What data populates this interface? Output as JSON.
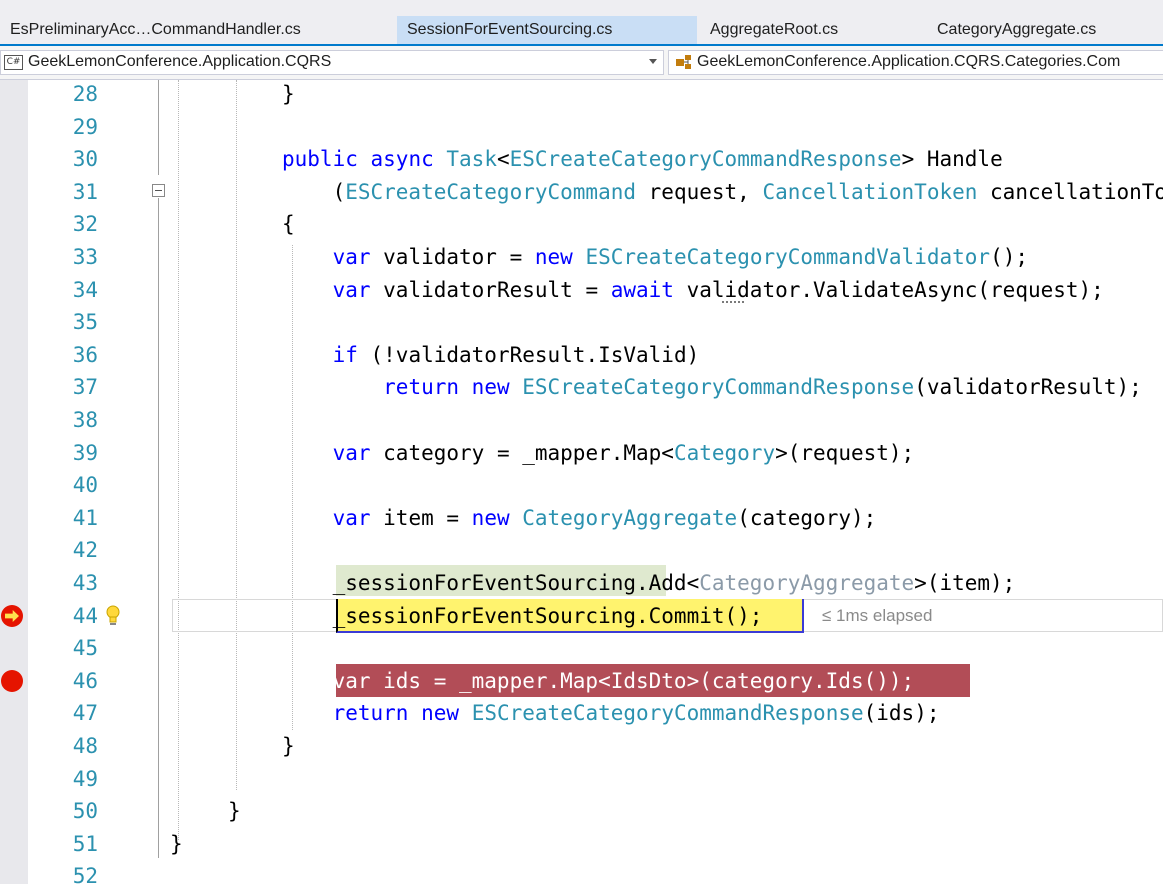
{
  "tabs": [
    {
      "label": "EsPreliminaryAcc…CommandHandler.cs",
      "active": false
    },
    {
      "label": "SessionForEventSourcing.cs",
      "active": true
    },
    {
      "label": "AggregateRoot.cs",
      "active": false
    },
    {
      "label": "CategoryAggregate.cs",
      "active": false
    }
  ],
  "navbar": {
    "language_icon": "C#",
    "project": "GeekLemonConference.Application.CQRS",
    "type": "GeekLemonConference.Application.CQRS.Categories.Com"
  },
  "editor": {
    "elapsed_hint": "≤ 1ms elapsed",
    "lines": [
      {
        "n": "28",
        "tokens": [
          {
            "c": "p",
            "s": "}"
          }
        ]
      },
      {
        "n": "29",
        "tokens": []
      },
      {
        "n": "30",
        "tokens": [
          {
            "c": "k",
            "s": "public"
          },
          {
            "c": "p",
            "s": " "
          },
          {
            "c": "k",
            "s": "async"
          },
          {
            "c": "p",
            "s": " "
          },
          {
            "c": "t",
            "s": "Task"
          },
          {
            "c": "p",
            "s": "<"
          },
          {
            "c": "t",
            "s": "ESCreateCategoryCommandResponse"
          },
          {
            "c": "p",
            "s": "> Handle"
          }
        ]
      },
      {
        "n": "31",
        "tokens": [
          {
            "c": "p",
            "s": "    ("
          },
          {
            "c": "t",
            "s": "ESCreateCategoryCommand"
          },
          {
            "c": "p",
            "s": " request, "
          },
          {
            "c": "t",
            "s": "CancellationToken"
          },
          {
            "c": "p",
            "s": " cancellationToken)"
          }
        ]
      },
      {
        "n": "32",
        "tokens": [
          {
            "c": "p",
            "s": "{"
          }
        ]
      },
      {
        "n": "33",
        "tokens": [
          {
            "c": "p",
            "s": "    "
          },
          {
            "c": "k",
            "s": "var"
          },
          {
            "c": "p",
            "s": " validator = "
          },
          {
            "c": "k",
            "s": "new"
          },
          {
            "c": "p",
            "s": " "
          },
          {
            "c": "t",
            "s": "ESCreateCategoryCommandValidator"
          },
          {
            "c": "p",
            "s": "();"
          }
        ]
      },
      {
        "n": "34",
        "tokens": [
          {
            "c": "p",
            "s": "    "
          },
          {
            "c": "k",
            "s": "var"
          },
          {
            "c": "p",
            "s": " validatorResult = "
          },
          {
            "c": "k",
            "s": "await"
          },
          {
            "c": "p",
            "s": " validator.ValidateAsync(request);"
          }
        ]
      },
      {
        "n": "35",
        "tokens": []
      },
      {
        "n": "36",
        "tokens": [
          {
            "c": "p",
            "s": "    "
          },
          {
            "c": "k",
            "s": "if"
          },
          {
            "c": "p",
            "s": " (!validatorResult.IsValid)"
          }
        ]
      },
      {
        "n": "37",
        "tokens": [
          {
            "c": "p",
            "s": "        "
          },
          {
            "c": "k",
            "s": "return"
          },
          {
            "c": "p",
            "s": " "
          },
          {
            "c": "k",
            "s": "new"
          },
          {
            "c": "p",
            "s": " "
          },
          {
            "c": "t",
            "s": "ESCreateCategoryCommandResponse"
          },
          {
            "c": "p",
            "s": "(validatorResult);"
          }
        ]
      },
      {
        "n": "38",
        "tokens": []
      },
      {
        "n": "39",
        "tokens": [
          {
            "c": "p",
            "s": "    "
          },
          {
            "c": "k",
            "s": "var"
          },
          {
            "c": "p",
            "s": " category = _mapper.Map<"
          },
          {
            "c": "t",
            "s": "Category"
          },
          {
            "c": "p",
            "s": ">(request);"
          }
        ]
      },
      {
        "n": "40",
        "tokens": []
      },
      {
        "n": "41",
        "tokens": [
          {
            "c": "p",
            "s": "    "
          },
          {
            "c": "k",
            "s": "var"
          },
          {
            "c": "p",
            "s": " item = "
          },
          {
            "c": "k",
            "s": "new"
          },
          {
            "c": "p",
            "s": " "
          },
          {
            "c": "t",
            "s": "CategoryAggregate"
          },
          {
            "c": "p",
            "s": "(category);"
          }
        ]
      },
      {
        "n": "42",
        "tokens": []
      },
      {
        "n": "43",
        "tokens": [
          {
            "c": "p",
            "s": "    _sessionForEventSourcing.Add<"
          },
          {
            "c": "g",
            "s": "CategoryAggregate"
          },
          {
            "c": "p",
            "s": ">(item);"
          }
        ]
      },
      {
        "n": "44",
        "tokens": [
          {
            "c": "p",
            "s": "    _sessionForEventSourcing.Commit();"
          }
        ]
      },
      {
        "n": "45",
        "tokens": []
      },
      {
        "n": "46",
        "tokens": [
          {
            "c": "p",
            "s": "    var ids = _mapper.Map<IdsDto>(category.Ids());"
          }
        ]
      },
      {
        "n": "47",
        "tokens": [
          {
            "c": "p",
            "s": "    "
          },
          {
            "c": "k",
            "s": "return"
          },
          {
            "c": "p",
            "s": " "
          },
          {
            "c": "k",
            "s": "new"
          },
          {
            "c": "p",
            "s": " "
          },
          {
            "c": "t",
            "s": "ESCreateCategoryCommandResponse"
          },
          {
            "c": "p",
            "s": "(ids);"
          }
        ]
      },
      {
        "n": "48",
        "tokens": [
          {
            "c": "p",
            "s": "}"
          }
        ]
      },
      {
        "n": "49",
        "tokens": []
      },
      {
        "n": "50",
        "tokens": [
          {
            "c": "p",
            "s": "}"
          }
        ]
      },
      {
        "n": "51",
        "tokens": [
          {
            "c": "p",
            "s": "}"
          }
        ]
      },
      {
        "n": "52",
        "tokens": []
      }
    ]
  }
}
